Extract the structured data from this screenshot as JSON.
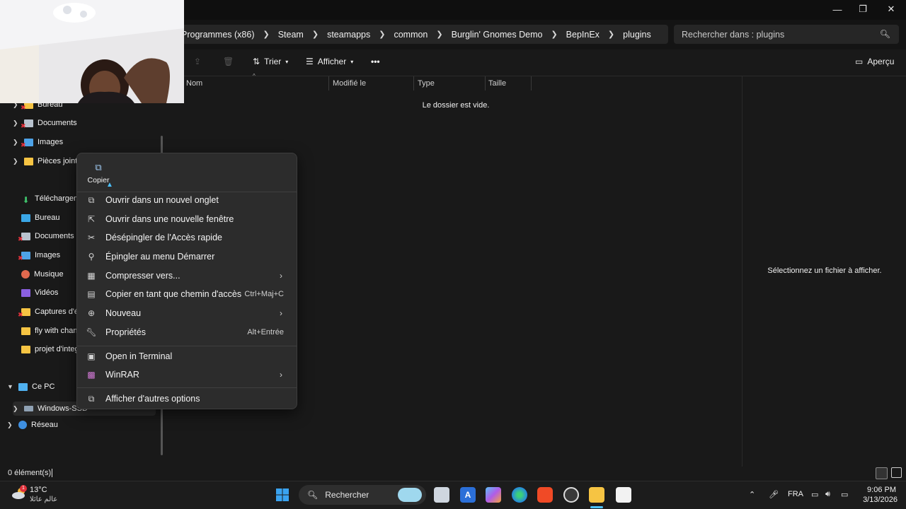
{
  "window": {
    "controls": {
      "minimize": "—",
      "maximize": "❐",
      "close": "✕"
    }
  },
  "breadcrumb": [
    "Programmes (x86)",
    "Steam",
    "steamapps",
    "common",
    "Burglin' Gnomes Demo",
    "BepInEx",
    "plugins"
  ],
  "search": {
    "placeholder": "Rechercher dans : plugins"
  },
  "toolbar": {
    "sort_label": "Trier",
    "view_label": "Afficher",
    "more_label": "•••",
    "preview_label": "Aperçu"
  },
  "sidebar": {
    "quick_access": [
      {
        "label": "Bureau",
        "icon": "desktop-folder-icon"
      },
      {
        "label": "Documents",
        "icon": "documents-icon"
      },
      {
        "label": "Images",
        "icon": "images-icon"
      },
      {
        "label": "Pièces jointes",
        "icon": "folder-icon"
      }
    ],
    "pinned": [
      {
        "label": "Téléchargemen",
        "icon": "download-icon"
      },
      {
        "label": "Bureau",
        "icon": "desktop-icon"
      },
      {
        "label": "Documents",
        "icon": "documents-icon"
      },
      {
        "label": "Images",
        "icon": "images-icon"
      },
      {
        "label": "Musique",
        "icon": "music-icon"
      },
      {
        "label": "Vidéos",
        "icon": "videos-icon"
      },
      {
        "label": "Captures d'écr",
        "icon": "folder-icon"
      },
      {
        "label": "fly with channe",
        "icon": "folder-icon"
      },
      {
        "label": "projet d'integr",
        "icon": "folder-icon"
      }
    ],
    "this_pc": "Ce PC",
    "drive": "Windows-SSD",
    "network": "Réseau"
  },
  "columns": [
    "Nom",
    "Modifié le",
    "Type",
    "Taille"
  ],
  "empty_message": "Le dossier est vide.",
  "preview_message": "Sélectionnez un fichier à afficher.",
  "status": {
    "count": "0 élément(s)"
  },
  "context_menu": {
    "copy_label": "Copier",
    "items": [
      {
        "label": "Ouvrir dans un nouvel onglet",
        "icon": "new-tab-icon"
      },
      {
        "label": "Ouvrir dans une nouvelle fenêtre",
        "icon": "new-window-icon"
      },
      {
        "label": "Désépingler de l'Accès rapide",
        "icon": "unpin-icon"
      },
      {
        "label": "Épingler au menu Démarrer",
        "icon": "pin-icon"
      },
      {
        "label": "Compresser vers...",
        "icon": "archive-icon",
        "submenu": true
      },
      {
        "label": "Copier en tant que chemin d'accès",
        "icon": "copy-path-icon",
        "shortcut": "Ctrl+Maj+C"
      },
      {
        "label": "Nouveau",
        "icon": "plus-icon",
        "submenu": true
      },
      {
        "label": "Propriétés",
        "icon": "properties-icon",
        "shortcut": "Alt+Entrée"
      },
      {
        "label": "Open in Terminal",
        "icon": "terminal-icon"
      },
      {
        "label": "WinRAR",
        "icon": "winrar-icon",
        "submenu": true
      },
      {
        "label": "Afficher d'autres options",
        "icon": "more-options-icon"
      }
    ]
  },
  "taskbar": {
    "weather_temp": "13°C",
    "weather_sub": "عالم عائلا",
    "search_label": "Rechercher",
    "language": "FRA",
    "time": "9:06 PM",
    "date": "3/13/2026"
  },
  "colors": {
    "accent": "#4cc2ff",
    "background": "#191919",
    "menu": "#2c2c2c"
  }
}
